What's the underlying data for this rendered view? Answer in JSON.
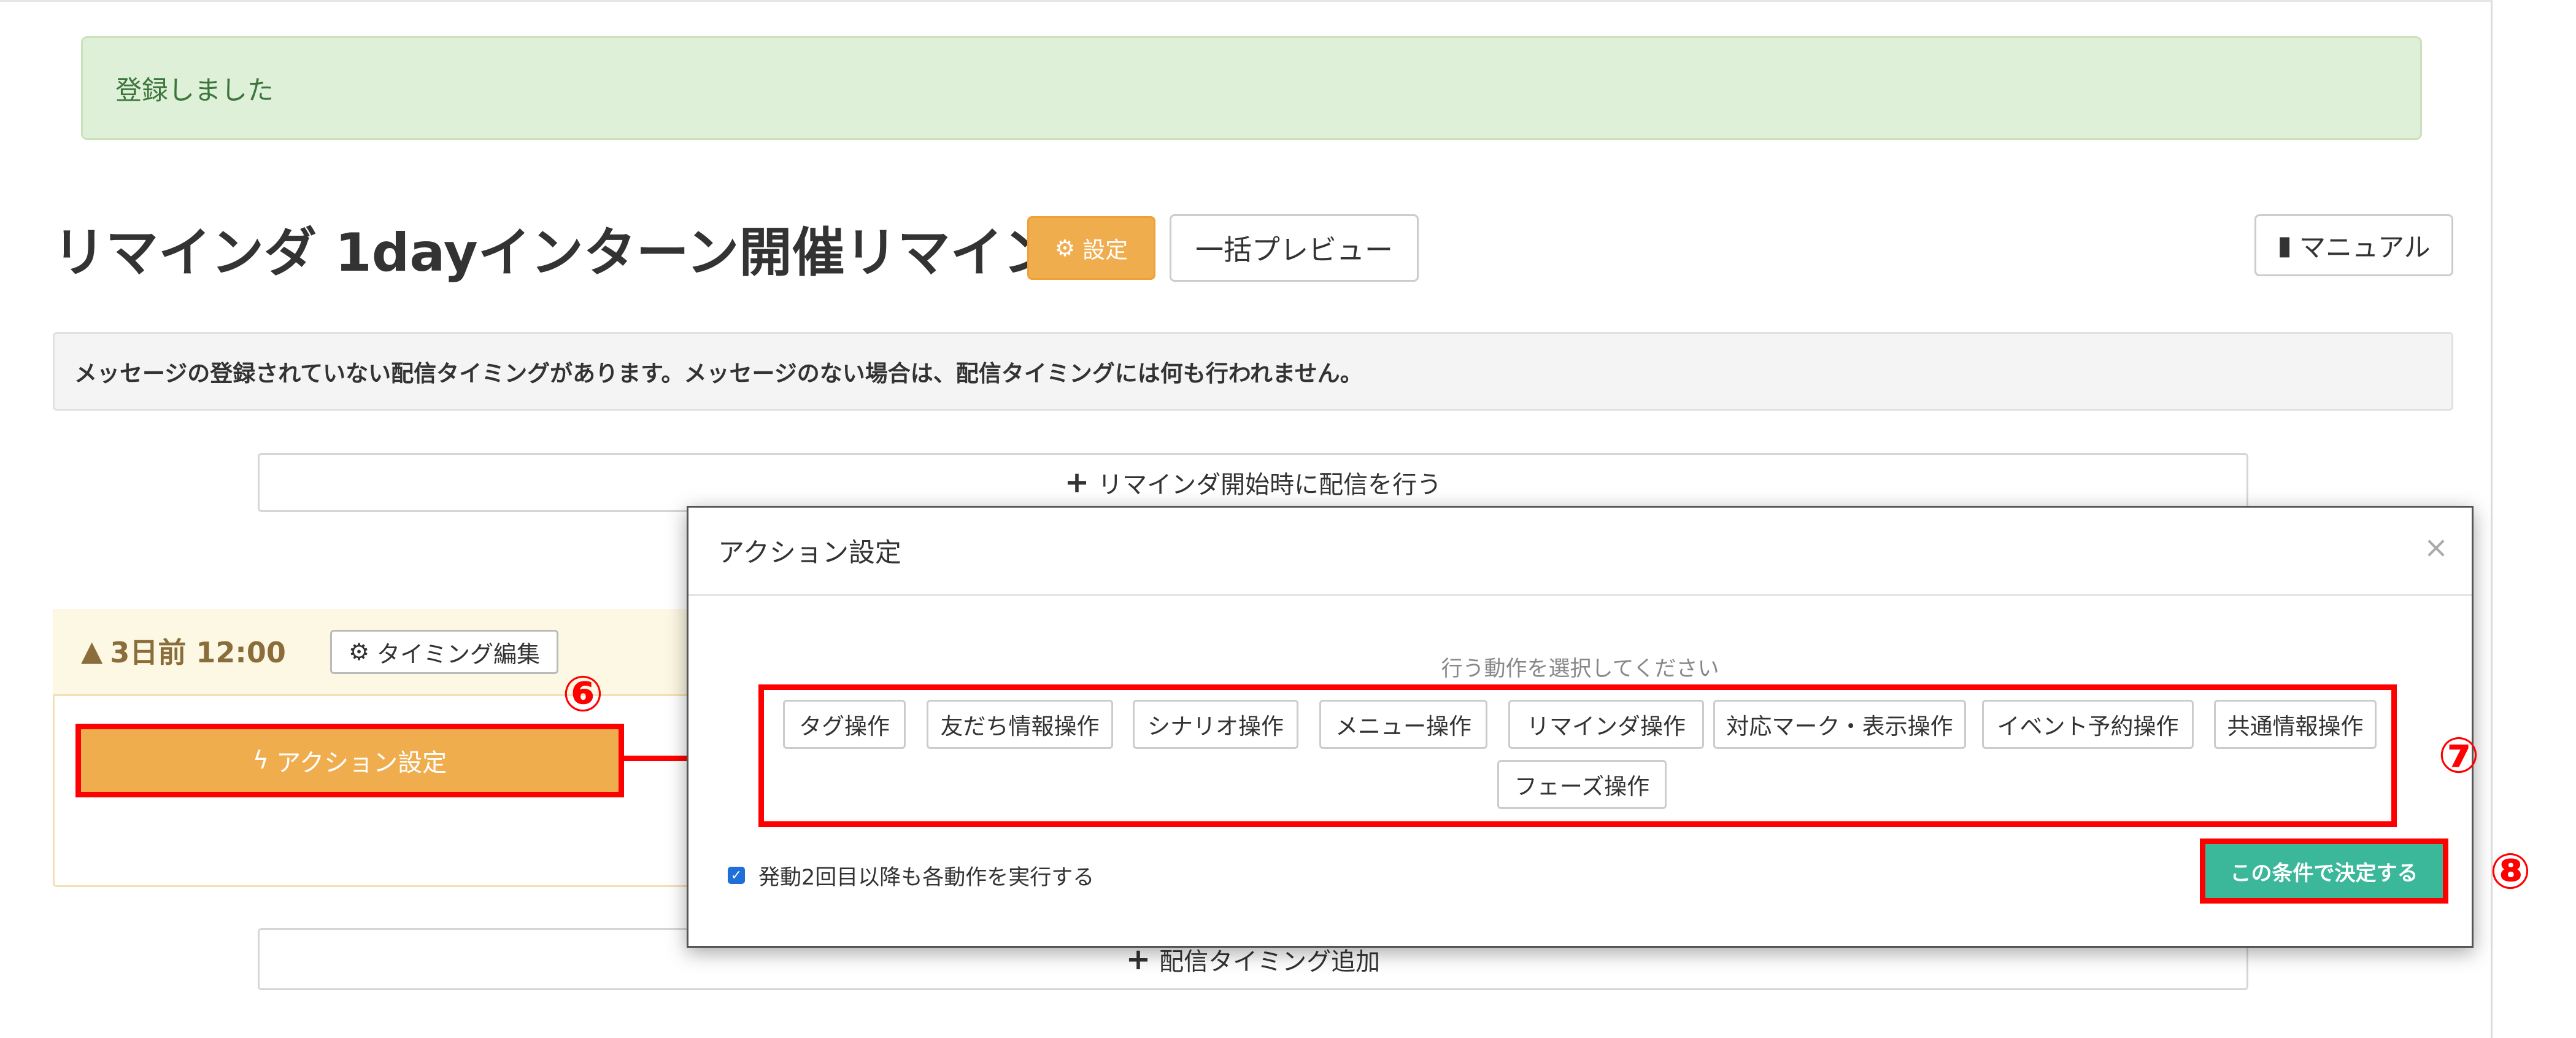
{
  "alert": {
    "text": "登録しました"
  },
  "header": {
    "title": "リマインダ 1dayインターン開催リマインド",
    "settings_label": "設定",
    "bulk_preview_label": "一括プレビュー",
    "manual_label": "マニュアル"
  },
  "warning": {
    "text": "メッセージの登録されていない配信タイミングがあります。メッセージのない場合は、配信タイミングには何も行われません。"
  },
  "start_delivery": {
    "label": "リマインダ開始時に配信を行う"
  },
  "timing": {
    "label": "3日前 12:00",
    "edit_label": "タイミング編集",
    "action_label": "アクション設定"
  },
  "add_timing": {
    "label": "配信タイミング追加"
  },
  "modal": {
    "title": "アクション設定",
    "close": "×",
    "hint": "行う動作を選択してください",
    "actions": [
      "タグ操作",
      "友だち情報操作",
      "シナリオ操作",
      "メニュー操作",
      "リマインダ操作",
      "対応マーク・表示操作",
      "イベント予約操作",
      "共通情報操作",
      "フェーズ操作"
    ],
    "repeat_label": "発動2回目以降も各動作を実行する",
    "repeat_checked": true,
    "decide_label": "この条件で決定する"
  },
  "annotations": {
    "n6": "⑥",
    "n7": "⑦",
    "n8": "⑧"
  },
  "colors": {
    "warning_orange": "#f0ad4e",
    "success_green": "#dff0d8",
    "decide_teal": "#3bb89a",
    "highlight_red": "#ff0000"
  }
}
